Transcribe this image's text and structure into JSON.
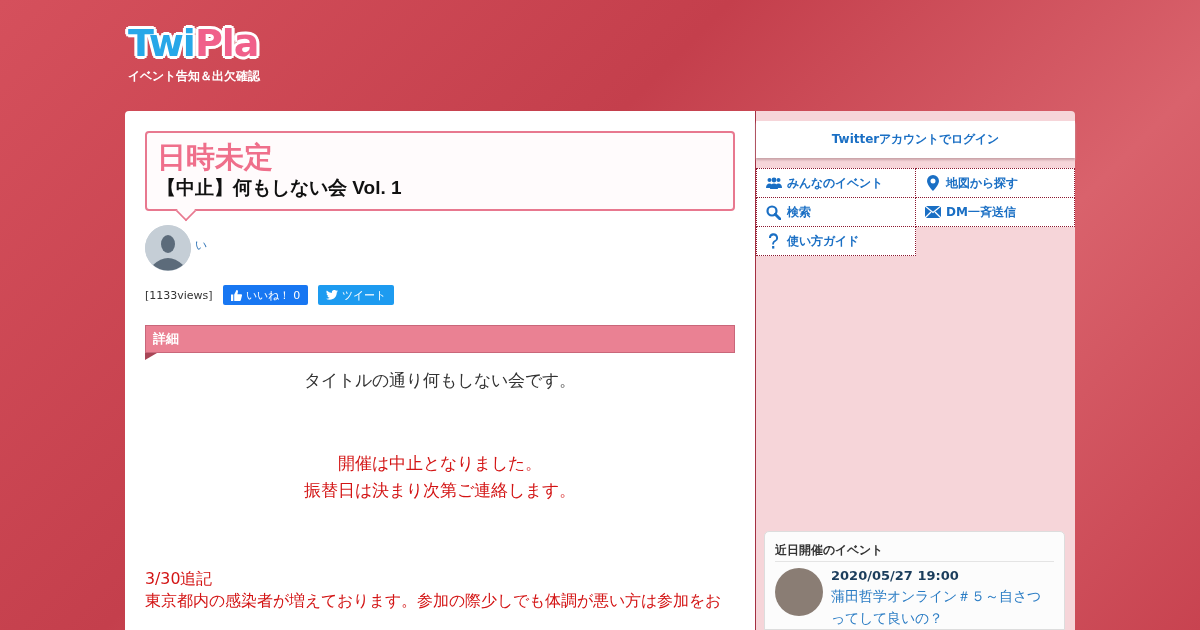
{
  "logo": {
    "part_1": "Twi",
    "part_2": "Pla",
    "tagline": "イベント告知＆出欠確認"
  },
  "event": {
    "date": "日時未定",
    "title": "【中止】何もしない会 Vol. 1",
    "organizer": "い",
    "views": "[1133views]",
    "like_button": "いいね！ 0",
    "tweet_button": "ツイート"
  },
  "details": {
    "heading": "詳細",
    "paragraphs": [
      {
        "kind": "center",
        "lines": [
          "タイトルの通り何もしない会です。"
        ]
      },
      {
        "kind": "notice",
        "lines": [
          "開催は中止となりました。",
          "振替日は決まり次第ご連絡します。"
        ]
      },
      {
        "kind": "update",
        "lines": [
          "3/30追記",
          "東京都内の感染者が増えております。参加の際少しでも体調が悪い方は参加をお"
        ]
      }
    ]
  },
  "sidebar": {
    "login": "Twitterアカウントでログイン",
    "nav": [
      {
        "kind": "people",
        "label": "みんなのイベント"
      },
      {
        "kind": "pin",
        "label": "地図から探す"
      },
      {
        "kind": "search",
        "label": "検索"
      },
      {
        "kind": "mail",
        "label": "DM一斉送信"
      },
      {
        "kind": "question",
        "label": "使い方ガイド"
      }
    ],
    "upcoming": {
      "heading": "近日開催のイベント",
      "events": [
        {
          "date": "2020/05/27 19:00",
          "title": "蒲田哲学オンライン＃５～自さつってして良いの？"
        }
      ]
    }
  }
}
